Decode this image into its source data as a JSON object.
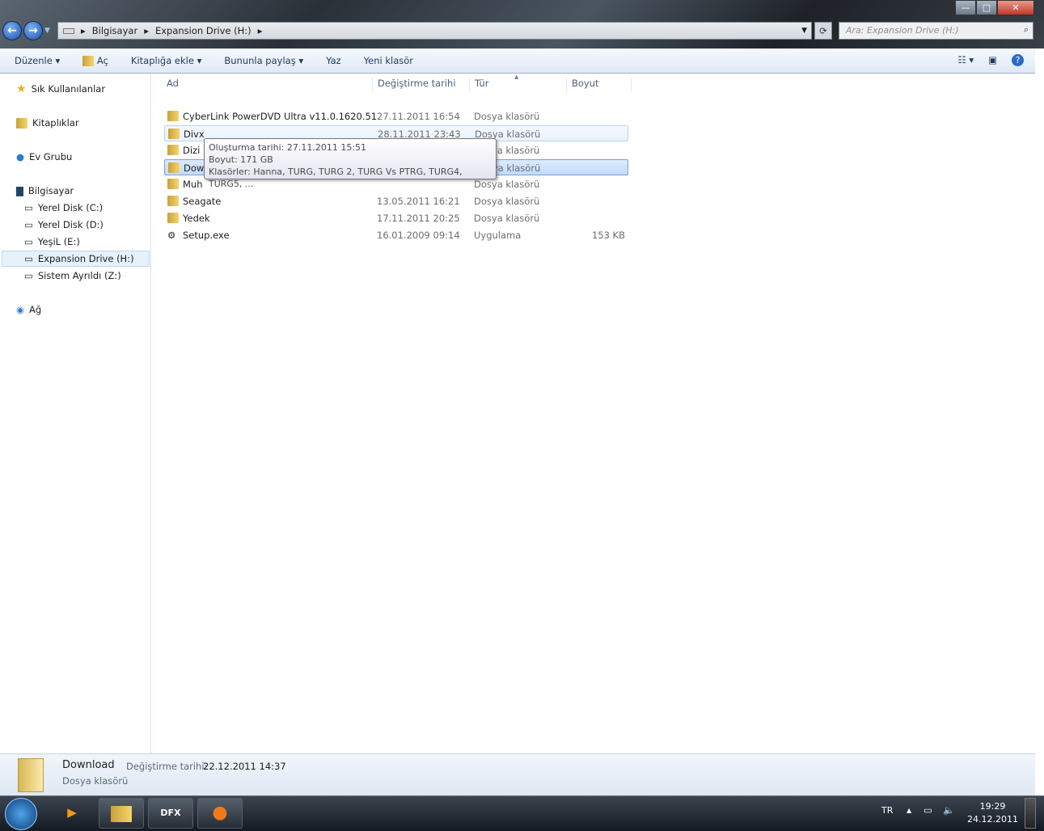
{
  "window": {
    "minimize": "—",
    "maximize": "□",
    "close": "✕"
  },
  "nav": {
    "back": "←",
    "forward": "→"
  },
  "address": {
    "crumbs": [
      "Bilgisayar",
      "Expansion Drive (H:)"
    ]
  },
  "search": {
    "placeholder": "Ara: Expansion Drive (H:)"
  },
  "toolbar": {
    "organize": "Düzenle",
    "open": "Aç",
    "include_library": "Kitaplığa ekle",
    "share": "Bununla paylaş",
    "burn": "Yaz",
    "new_folder": "Yeni klasör"
  },
  "sidebar": {
    "favorites": "Sık Kullanılanlar",
    "libraries": "Kitaplıklar",
    "homegroup": "Ev Grubu",
    "computer": "Bilgisayar",
    "drives": [
      "Yerel Disk (C:)",
      "Yerel Disk (D:)",
      "YeşiL (E:)",
      "Expansion Drive (H:)",
      "Sistem Ayrıldı (Z:)"
    ],
    "network": "Ağ"
  },
  "columns": {
    "name": "Ad",
    "date": "Değiştirme tarihi",
    "type": "Tür",
    "size": "Boyut"
  },
  "files": [
    {
      "name": "CyberLink PowerDVD Ultra v11.0.1620.51",
      "date": "27.11.2011 16:54",
      "type": "Dosya klasörü",
      "size": ""
    },
    {
      "name": "Divx",
      "date": "28.11.2011 23:43",
      "type": "Dosya klasörü",
      "size": ""
    },
    {
      "name": "Dizi",
      "date": "",
      "type": "Dosya klasörü",
      "size": ""
    },
    {
      "name": "Dow",
      "date": "",
      "type": "Dosya klasörü",
      "size": ""
    },
    {
      "name": "Muh",
      "date": "",
      "type": "Dosya klasörü",
      "size": ""
    },
    {
      "name": "Seagate",
      "date": "13.05.2011 16:21",
      "type": "Dosya klasörü",
      "size": ""
    },
    {
      "name": "Yedek",
      "date": "17.11.2011 20:25",
      "type": "Dosya klasörü",
      "size": ""
    },
    {
      "name": "Setup.exe",
      "date": "16.01.2009 09:14",
      "type": "Uygulama",
      "size": "153 KB"
    }
  ],
  "tooltip": {
    "created": "Oluşturma tarihi: 27.11.2011 15:51",
    "size": "Boyut: 171 GB",
    "folders": "Klasörler: Hanna, TURG, TURG 2, TURG Vs PTRG, TURG4, TURG5, ..."
  },
  "details": {
    "name": "Download",
    "type": "Dosya klasörü",
    "modified_label": "Değiştirme tarihi:",
    "modified": "22.12.2011 14:37"
  },
  "taskbar": {
    "lang": "TR",
    "time": "19:29",
    "date": "24.12.2011",
    "dfx": "DFX"
  }
}
